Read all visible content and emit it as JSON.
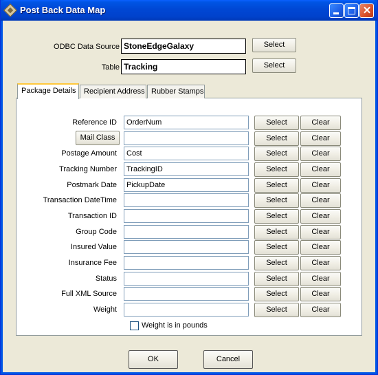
{
  "window": {
    "title": "Post Back Data Map",
    "icon": "app-diamond-icon"
  },
  "source": {
    "odbc_label": "ODBC Data Source",
    "odbc_value": "StoneEdgeGalaxy",
    "table_label": "Table",
    "table_value": "Tracking",
    "select_label": "Select"
  },
  "tabs": [
    "Package Details",
    "Recipient Address",
    "Rubber Stamps"
  ],
  "rows": [
    {
      "label": "Reference ID",
      "value": "OrderNum",
      "is_button": false
    },
    {
      "label": "Mail Class",
      "value": "",
      "is_button": true
    },
    {
      "label": "Postage Amount",
      "value": "Cost",
      "is_button": false
    },
    {
      "label": "Tracking Number",
      "value": "TrackingID",
      "is_button": false
    },
    {
      "label": "Postmark Date",
      "value": "PickupDate",
      "is_button": false
    },
    {
      "label": "Transaction DateTime",
      "value": "",
      "is_button": false
    },
    {
      "label": "Transaction ID",
      "value": "",
      "is_button": false
    },
    {
      "label": "Group Code",
      "value": "",
      "is_button": false
    },
    {
      "label": "Insured Value",
      "value": "",
      "is_button": false
    },
    {
      "label": "Insurance Fee",
      "value": "",
      "is_button": false
    },
    {
      "label": "Status",
      "value": "",
      "is_button": false
    },
    {
      "label": "Full XML Source",
      "value": "",
      "is_button": false
    },
    {
      "label": "Weight",
      "value": "",
      "is_button": false
    }
  ],
  "row_buttons": {
    "select": "Select",
    "clear": "Clear"
  },
  "weight_checkbox": {
    "label": "Weight is in pounds",
    "checked": false
  },
  "footer": {
    "ok": "OK",
    "cancel": "Cancel"
  }
}
